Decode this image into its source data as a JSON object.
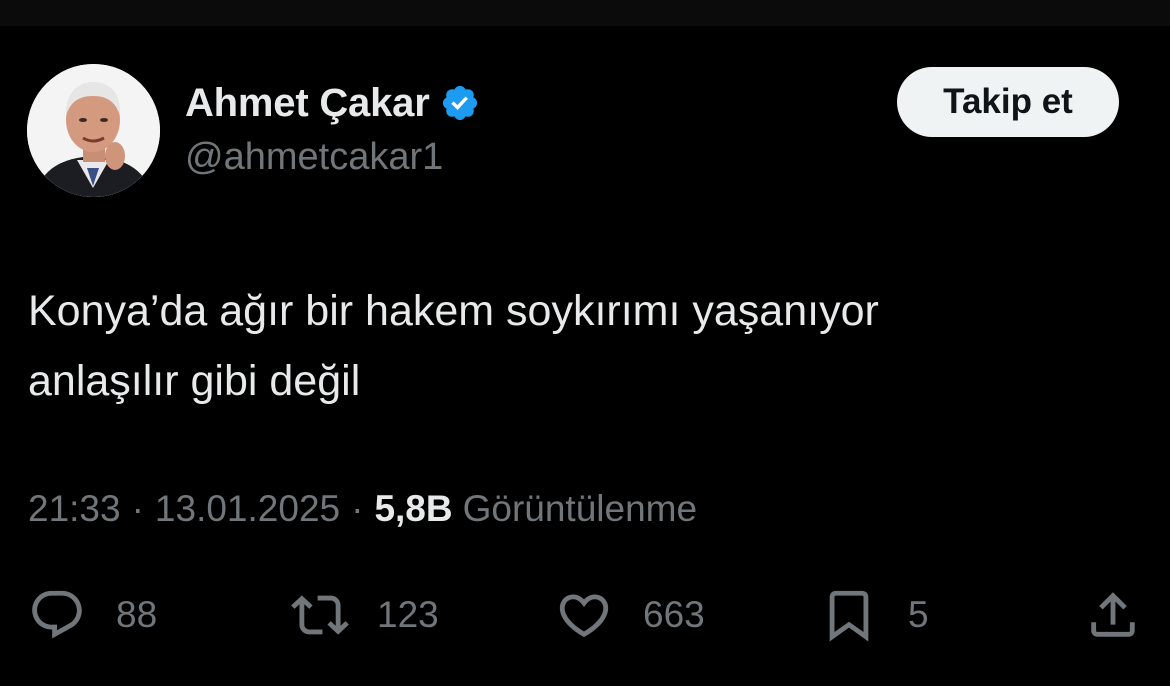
{
  "author": {
    "display_name": "Ahmet Çakar",
    "handle": "@ahmetcakar1",
    "verified_icon": "verified-badge-icon"
  },
  "follow_button": {
    "label": "Takip et"
  },
  "tweet": {
    "lines": [
      "Konya’da ağır bir hakem soykırımı yaşanıyor",
      "anlaşılır gibi değil"
    ]
  },
  "meta": {
    "time": "21:33",
    "separator": "·",
    "date": "13.01.2025",
    "views_count": "5,8B",
    "views_label": "Görüntülenme"
  },
  "actions": {
    "reply": {
      "icon": "reply-icon",
      "count": "88"
    },
    "retweet": {
      "icon": "retweet-icon",
      "count": "123"
    },
    "like": {
      "icon": "heart-icon",
      "count": "663"
    },
    "bookmark": {
      "icon": "bookmark-icon",
      "count": "5"
    },
    "share": {
      "icon": "share-icon"
    }
  },
  "colors": {
    "background": "#000000",
    "text_primary": "#e7e9ea",
    "text_secondary": "#71767b",
    "verified_blue": "#1d9bf0",
    "button_bg": "#eff3f4"
  }
}
